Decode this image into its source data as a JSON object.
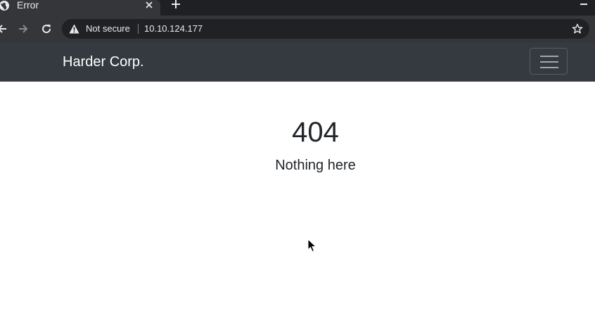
{
  "browser": {
    "tab": {
      "title": "Error",
      "favicon": "globe-icon"
    },
    "new_tab_icon": "plus-icon",
    "address_bar": {
      "security_label": "Not secure",
      "security_icon": "warning-icon",
      "url": "10.10.124.177",
      "bookmark_icon": "star-icon"
    },
    "nav_icons": [
      "back-arrow-icon",
      "forward-arrow-icon",
      "reload-icon"
    ]
  },
  "site": {
    "brand": "Harder Corp.",
    "menu_toggle_icon": "hamburger-icon",
    "navbar_color": "#343a40"
  },
  "error": {
    "code": "404",
    "message": "Nothing here"
  }
}
